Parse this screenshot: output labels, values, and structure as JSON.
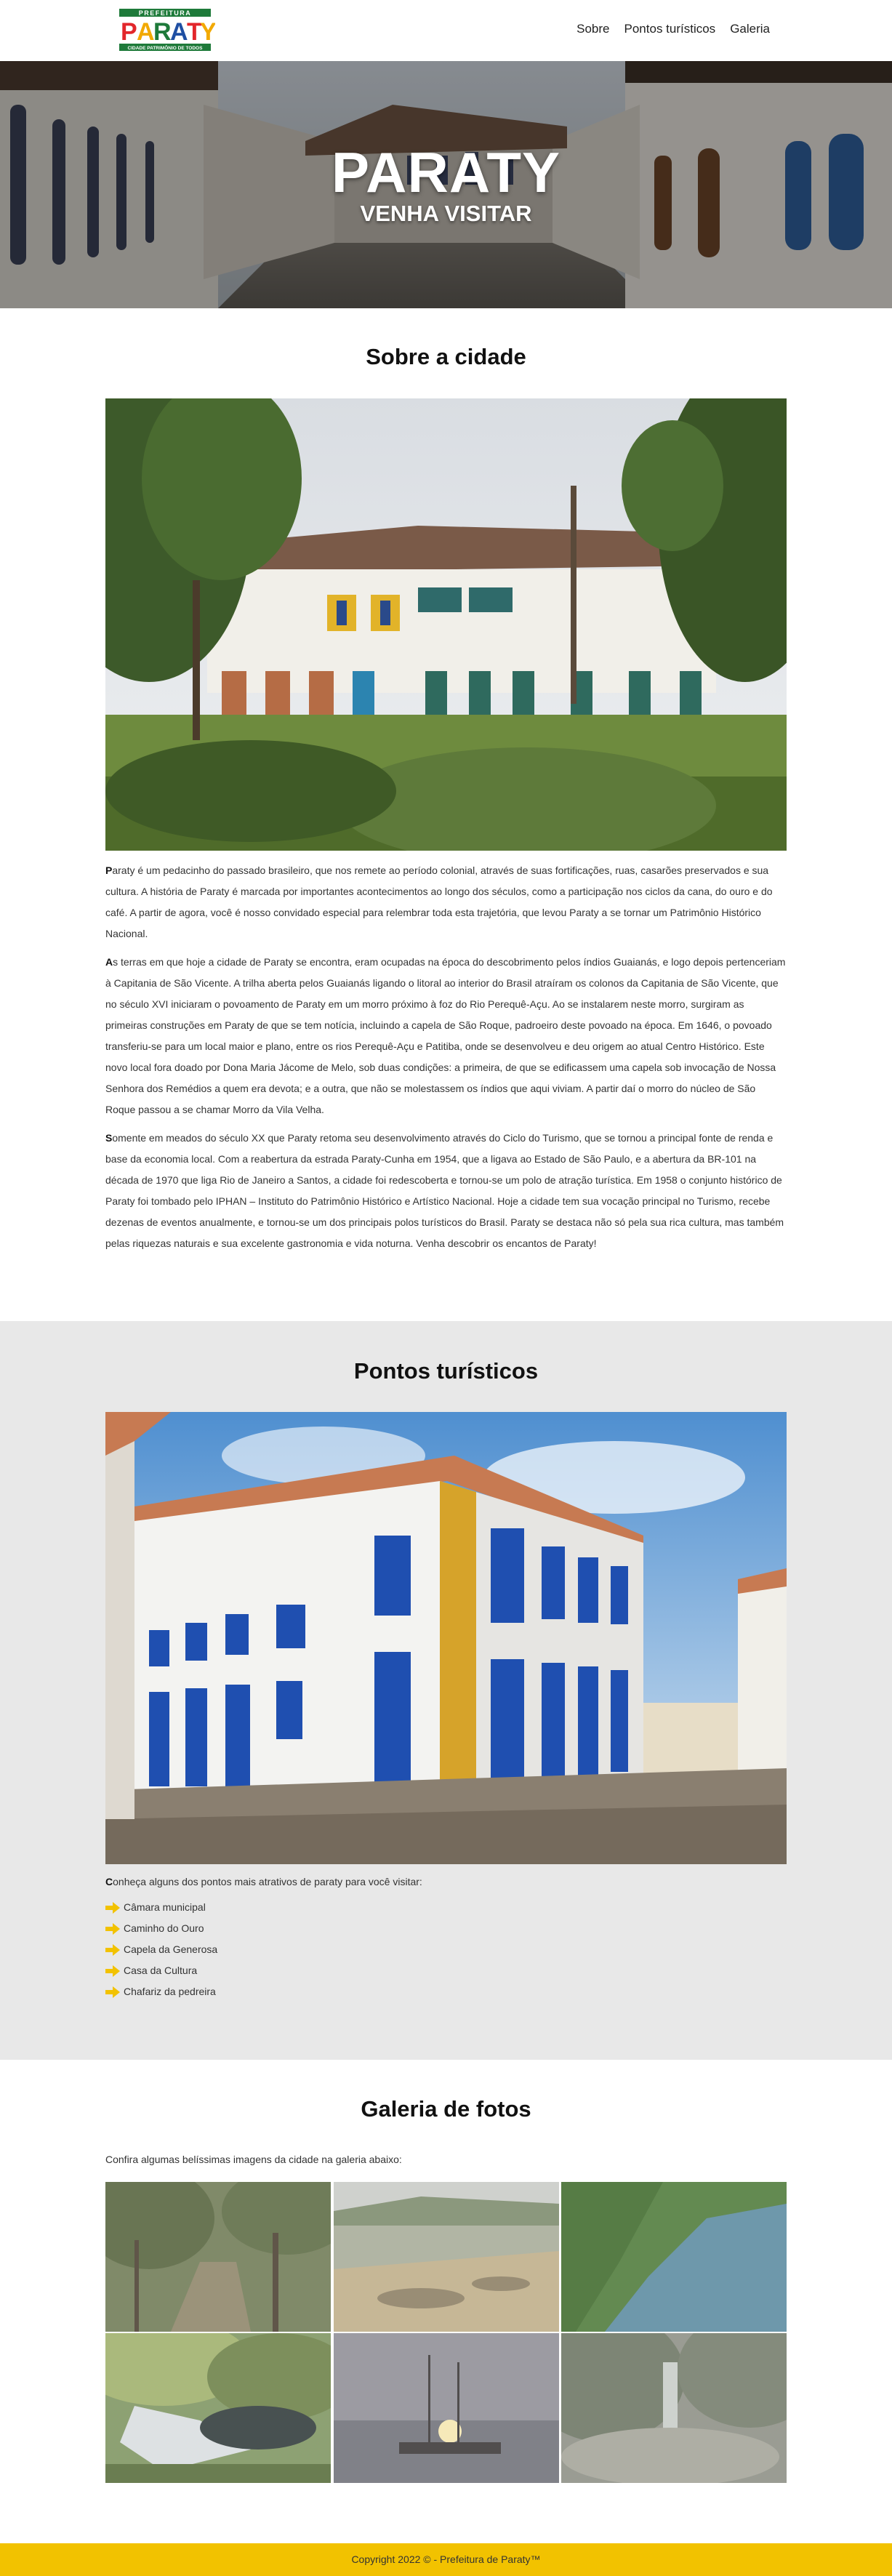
{
  "header": {
    "logo": {
      "top": "PREFEITURA",
      "main": "PARATY",
      "bottom": "CIDADE PATRIMÔNIO DE TODOS"
    },
    "nav": [
      "Sobre",
      "Pontos turísticos",
      "Galeria"
    ]
  },
  "hero": {
    "title": "PARATY",
    "subtitle": "VENHA VISITAR"
  },
  "sobre": {
    "title": "Sobre a cidade",
    "paragraphs": [
      {
        "first": "P",
        "rest": "araty é um pedacinho do passado brasileiro, que nos remete ao período colonial, através de suas fortificações, ruas, casarões preservados e sua cultura. A história de Paraty é marcada por importantes acontecimentos ao longo dos séculos, como a participação nos ciclos da cana, do ouro e do café. A partir de agora, você é nosso convidado especial para relembrar toda esta trajetória, que levou Paraty a se tornar um Patrimônio Histórico Nacional."
      },
      {
        "first": "A",
        "rest": "s terras em que hoje a cidade de Paraty se encontra, eram ocupadas na época do descobrimento pelos índios Guaianás, e logo depois pertenceriam à Capitania de São Vicente. A trilha aberta pelos Guaianás ligando o litoral ao interior do Brasil atraíram os colonos da Capitania de São Vicente, que no século XVI iniciaram o povoamento de Paraty em um morro próximo à foz do Rio Perequê-Açu. Ao se instalarem neste morro, surgiram as primeiras construções em Paraty de que se tem notícia, incluindo a capela de São Roque, padroeiro deste povoado na época. Em 1646, o povoado transferiu-se para um local maior e plano, entre os rios Perequê-Açu e Patitiba, onde se desenvolveu e deu origem ao atual Centro Histórico. Este novo local fora doado por Dona Maria Jácome de Melo, sob duas condições: a primeira, de que se edificassem uma capela sob invocação de Nossa Senhora dos Remédios a quem era devota; e a outra, que não se molestassem os índios que aqui viviam. A partir daí o morro do núcleo de São Roque passou a se chamar Morro da Vila Velha."
      },
      {
        "first": "S",
        "rest": "omente em meados do século XX que Paraty retoma seu desenvolvimento através do Ciclo do Turismo, que se tornou a principal fonte de renda e base da economia local. Com a reabertura da estrada Paraty-Cunha em 1954, que a ligava ao Estado de São Paulo, e a abertura da BR-101 na década de 1970 que liga Rio de Janeiro a Santos, a cidade foi redescoberta e tornou-se um polo de atração turística. Em 1958 o conjunto histórico de Paraty foi tombado pelo IPHAN – Instituto do Patrimônio Histórico e Artístico Nacional. Hoje a cidade tem sua vocação principal no Turismo, recebe dezenas de eventos anualmente, e tornou-se um dos principais polos turísticos do Brasil. Paraty se destaca não só pela sua rica cultura, mas também pelas riquezas naturais e sua excelente gastronomia e vida noturna. Venha descobrir os encantos de Paraty!"
      }
    ]
  },
  "pontos": {
    "title": "Pontos turísticos",
    "intro_first": "C",
    "intro_rest": "onheça alguns dos pontos mais atrativos de paraty para você visitar:",
    "items": [
      "Câmara municipal",
      "Caminho do Ouro",
      "Capela da Generosa",
      "Casa da Cultura",
      "Chafariz da pedreira"
    ]
  },
  "galeria": {
    "title": "Galeria de fotos",
    "intro": "Confira algumas belíssimas imagens da cidade na galeria abaixo:"
  },
  "footer": {
    "text": "Copyright 2022 © - Prefeitura de Paraty™"
  },
  "colors": {
    "accent": "#f2c200",
    "section_bg": "#e8e8e8",
    "logo_green": "#1e7a3a",
    "logo_blue": "#1f4fa3"
  }
}
